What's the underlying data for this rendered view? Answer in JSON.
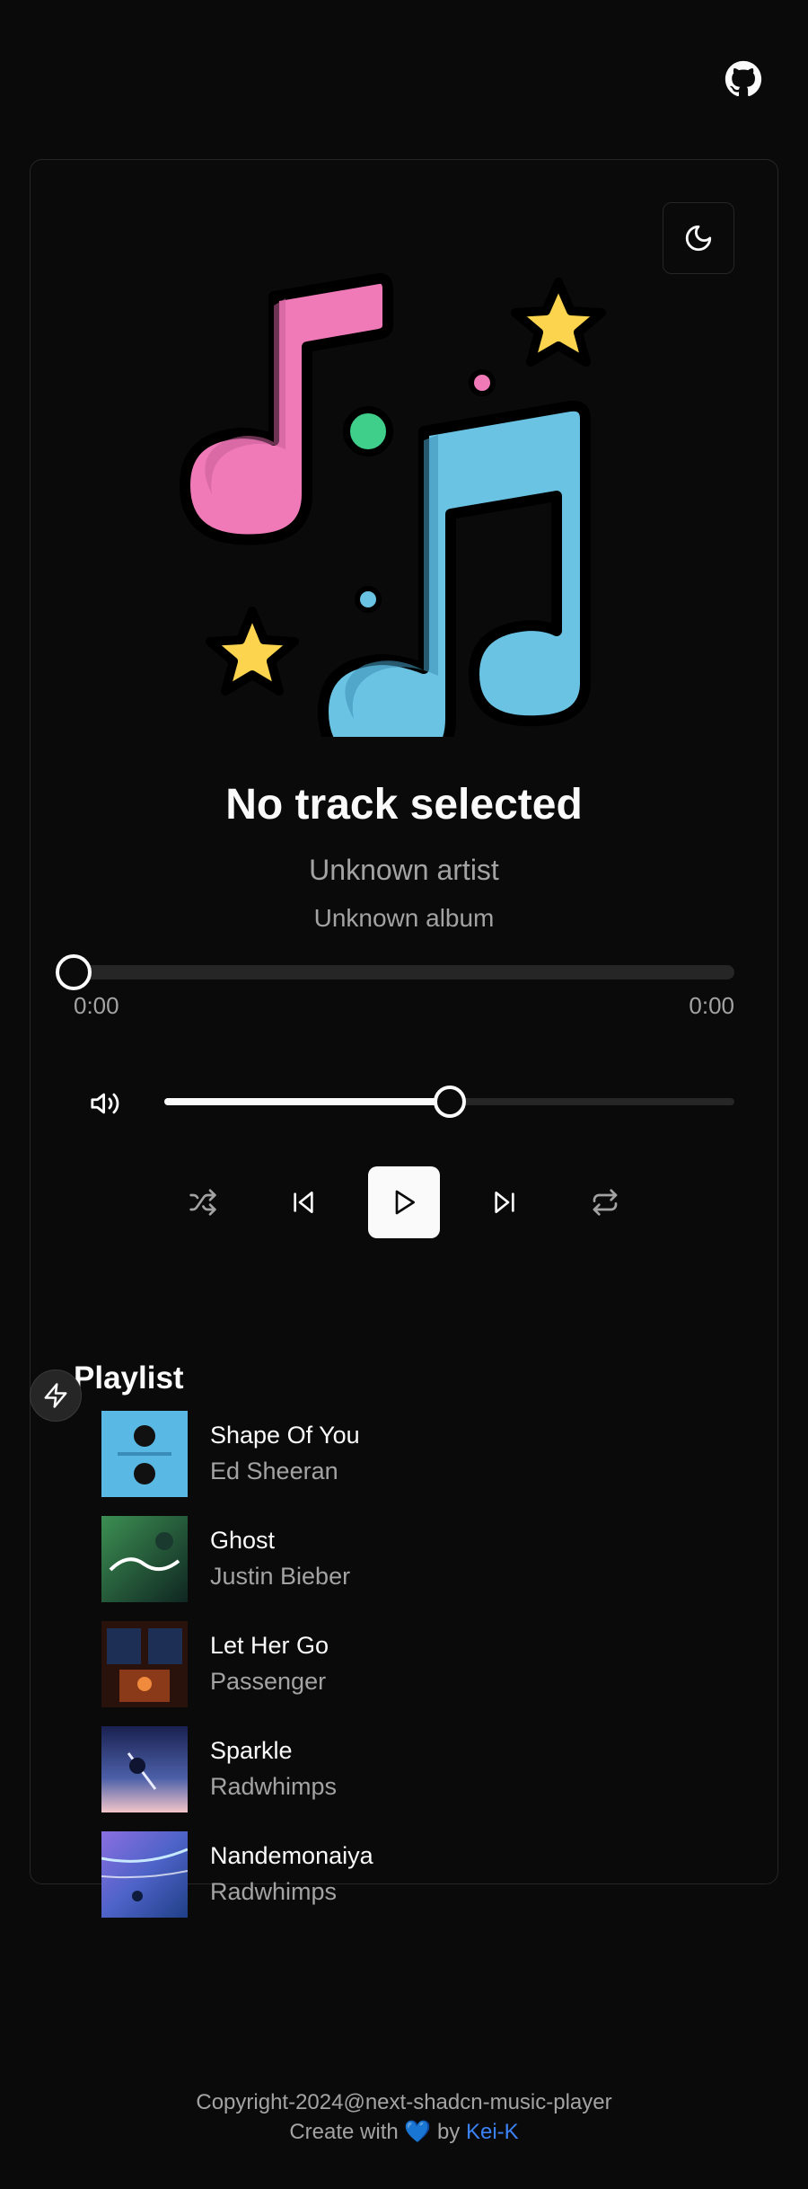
{
  "header": {
    "github_icon": "github-icon"
  },
  "theme_toggle": {
    "icon": "moon-icon"
  },
  "now_playing": {
    "title": "No track selected",
    "artist": "Unknown artist",
    "album": "Unknown album",
    "artwork_icon": "music-notes-illustration",
    "progress_fraction": 0,
    "time_current": "0:00",
    "time_total": "0:00"
  },
  "volume": {
    "icon": "volume-icon",
    "level_fraction": 0.5
  },
  "controls": {
    "shuffle_icon": "shuffle-icon",
    "previous_icon": "skip-back-icon",
    "play_icon": "play-icon",
    "next_icon": "skip-forward-icon",
    "repeat_icon": "repeat-icon"
  },
  "playlist": {
    "heading": "Playlist",
    "bolt_icon": "zap-icon",
    "items": [
      {
        "name": "Shape Of You",
        "artist": "Ed Sheeran",
        "cover_colors": [
          "#5ab9e4",
          "#3fa5d6"
        ]
      },
      {
        "name": "Ghost",
        "artist": "Justin Bieber",
        "cover_colors": [
          "#2f7a45",
          "#14302a"
        ]
      },
      {
        "name": "Let Her Go",
        "artist": "Passenger",
        "cover_colors": [
          "#3a1a12",
          "#c25a24"
        ]
      },
      {
        "name": "Sparkle",
        "artist": "Radwhimps",
        "cover_colors": [
          "#1e2a5a",
          "#f2c6c9"
        ]
      },
      {
        "name": "Nandemonaiya",
        "artist": "Radwhimps",
        "cover_colors": [
          "#6a5bd6",
          "#2b4c9a"
        ]
      }
    ]
  },
  "footer": {
    "copyright": "Copyright-2024@next-shadcn-music-player",
    "credit_prefix": "Create with 💙 by ",
    "credit_link": "Kei-K"
  },
  "colors": {
    "background": "#0a0a0a",
    "border": "#262626",
    "foreground": "#fafafa",
    "muted": "#a3a3a3",
    "link": "#3b82f6",
    "note_pink": "#f07ab7",
    "note_blue": "#6ac3e3",
    "star": "#fdd44d",
    "dot_green": "#3fcf8a"
  }
}
